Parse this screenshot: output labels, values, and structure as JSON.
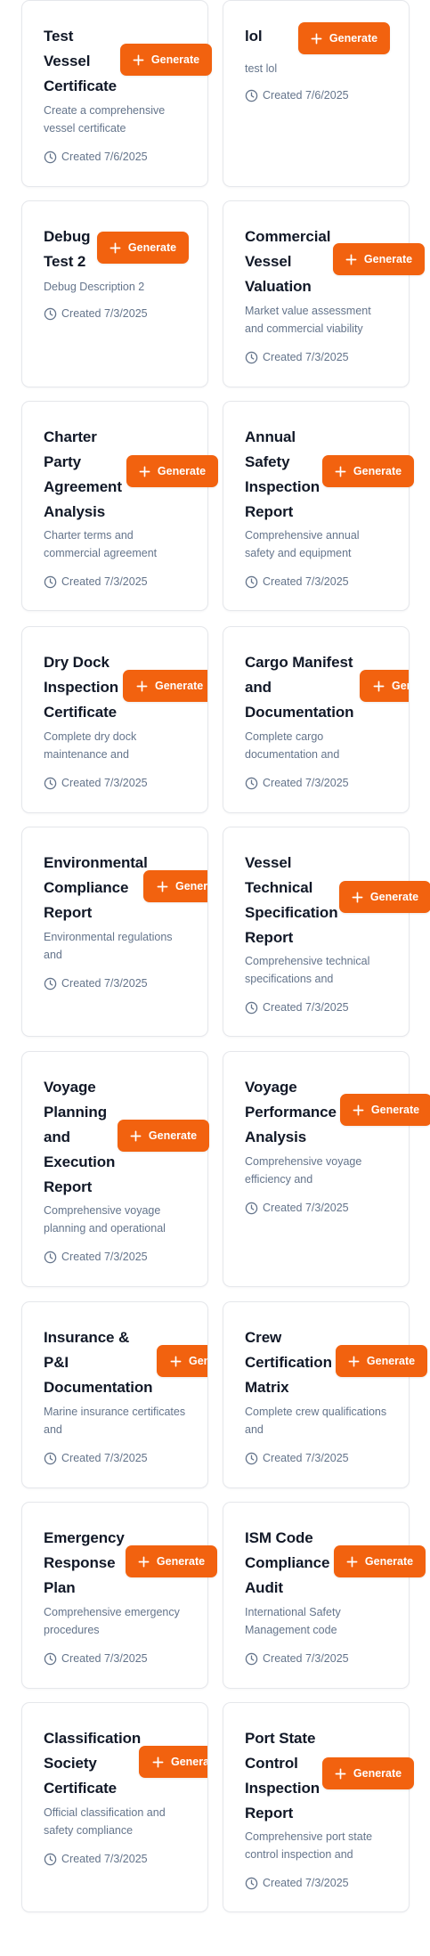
{
  "cards": [
    {
      "id": "test-vessel-certificate",
      "title": "Test Vessel Certificate",
      "title_lines": [
        "Test",
        "Vessel",
        "Certificate"
      ],
      "description": "Create a comprehensive vessel certificate",
      "created": "Created 7/6/2025",
      "generate_label": "Generate"
    },
    {
      "id": "lol",
      "title": "lol",
      "title_lines": [
        "lol"
      ],
      "description": "test lol",
      "created": "Created 7/6/2025",
      "generate_label": "Generate"
    },
    {
      "id": "debug-test-2",
      "title": "Debug Test 2",
      "title_lines": [
        "Debug",
        "Test 2"
      ],
      "description": "Debug Description 2",
      "created": "Created 7/3/2025",
      "generate_label": "Generate"
    },
    {
      "id": "commercial-vessel-valuation",
      "title": "Commercial Vessel Valuation",
      "title_lines": [
        "Commercial",
        "Vessel",
        "Valuation"
      ],
      "description": "Market value assessment and commercial viability",
      "created": "Created 7/3/2025",
      "generate_label": "Generate"
    },
    {
      "id": "charter-party-agreement-analysis",
      "title": "Charter Party Agreement Analysis",
      "title_lines": [
        "Charter",
        "Party",
        "Agreement",
        "Analysis"
      ],
      "description": "Charter terms and commercial agreement",
      "created": "Created 7/3/2025",
      "generate_label": "Generate"
    },
    {
      "id": "annual-safety-inspection-report",
      "title": "Annual Safety Inspection Report",
      "title_lines": [
        "Annual",
        "Safety",
        "Inspection",
        "Report"
      ],
      "description": "Comprehensive annual safety and equipment",
      "created": "Created 7/3/2025",
      "generate_label": "Generate"
    },
    {
      "id": "dry-dock-inspection-certificate",
      "title": "Dry Dock Inspection Certificate",
      "title_lines": [
        "Dry Dock",
        "Inspection",
        "Certificate"
      ],
      "description": "Complete dry dock maintenance and",
      "created": "Created 7/3/2025",
      "generate_label": "Generate"
    },
    {
      "id": "cargo-manifest-and-documentation",
      "title": "Cargo Manifest and Documentation",
      "title_lines": [
        "Cargo Manifest",
        "and",
        "Documentation"
      ],
      "description": "Complete cargo documentation and",
      "created": "Created 7/3/2025",
      "generate_label": "Generate"
    },
    {
      "id": "environmental-compliance-report",
      "title": "Environmental Compliance Report",
      "title_lines": [
        "Environmental",
        "Compliance",
        "Report"
      ],
      "description": "Environmental regulations and",
      "created": "Created 7/3/2025",
      "generate_label": "Generate"
    },
    {
      "id": "vessel-technical-specification-report",
      "title": "Vessel Technical Specification Report",
      "title_lines": [
        "Vessel",
        "Technical",
        "Specification",
        "Report"
      ],
      "description": "Comprehensive technical specifications and",
      "created": "Created 7/3/2025",
      "generate_label": "Generate"
    },
    {
      "id": "voyage-planning-and-execution-report",
      "title": "Voyage Planning and Execution Report",
      "title_lines": [
        "Voyage",
        "Planning",
        "and",
        "Execution",
        "Report"
      ],
      "description": "Comprehensive voyage planning and operational",
      "created": "Created 7/3/2025",
      "generate_label": "Generate"
    },
    {
      "id": "voyage-performance-analysis",
      "title": "Voyage Performance Analysis",
      "title_lines": [
        "Voyage",
        "Performance",
        "Analysis"
      ],
      "description": "Comprehensive voyage efficiency and",
      "created": "Created 7/3/2025",
      "generate_label": "Generate"
    },
    {
      "id": "insurance-and-pi-documentation",
      "title": "Insurance & P&I Documentation",
      "title_lines": [
        "Insurance &",
        "P&I",
        "Documentation"
      ],
      "description": "Marine insurance certificates and",
      "created": "Created 7/3/2025",
      "generate_label": "Generate"
    },
    {
      "id": "crew-certification-matrix",
      "title": "Crew Certification Matrix",
      "title_lines": [
        "Crew",
        "Certification",
        "Matrix"
      ],
      "description": "Complete crew qualifications and",
      "created": "Created 7/3/2025",
      "generate_label": "Generate"
    },
    {
      "id": "emergency-response-plan",
      "title": "Emergency Response Plan",
      "title_lines": [
        "Emergency",
        "Response",
        "Plan"
      ],
      "description": "Comprehensive emergency procedures",
      "created": "Created 7/3/2025",
      "generate_label": "Generate"
    },
    {
      "id": "ism-code-compliance-audit",
      "title": "ISM Code Compliance Audit",
      "title_lines": [
        "ISM Code",
        "Compliance",
        "Audit"
      ],
      "description": "International Safety Management code",
      "created": "Created 7/3/2025",
      "generate_label": "Generate"
    },
    {
      "id": "classification-society-certificate",
      "title": "Classification Society Certificate",
      "title_lines": [
        "Classification",
        "Society",
        "Certificate"
      ],
      "description": "Official classification and safety compliance",
      "created": "Created 7/3/2025",
      "generate_label": "Generate"
    },
    {
      "id": "port-state-control-inspection-report",
      "title": "Port State Control Inspection Report",
      "title_lines": [
        "Port State",
        "Control",
        "Inspection",
        "Report"
      ],
      "description": "Comprehensive port state control inspection and",
      "created": "Created 7/3/2025",
      "generate_label": "Generate"
    }
  ],
  "colors": {
    "accent": "#f2620f",
    "title": "#111827",
    "muted": "#64748b",
    "border": "#e5e7eb"
  },
  "icons": {
    "generate": "plus-icon",
    "created": "clock-icon"
  }
}
